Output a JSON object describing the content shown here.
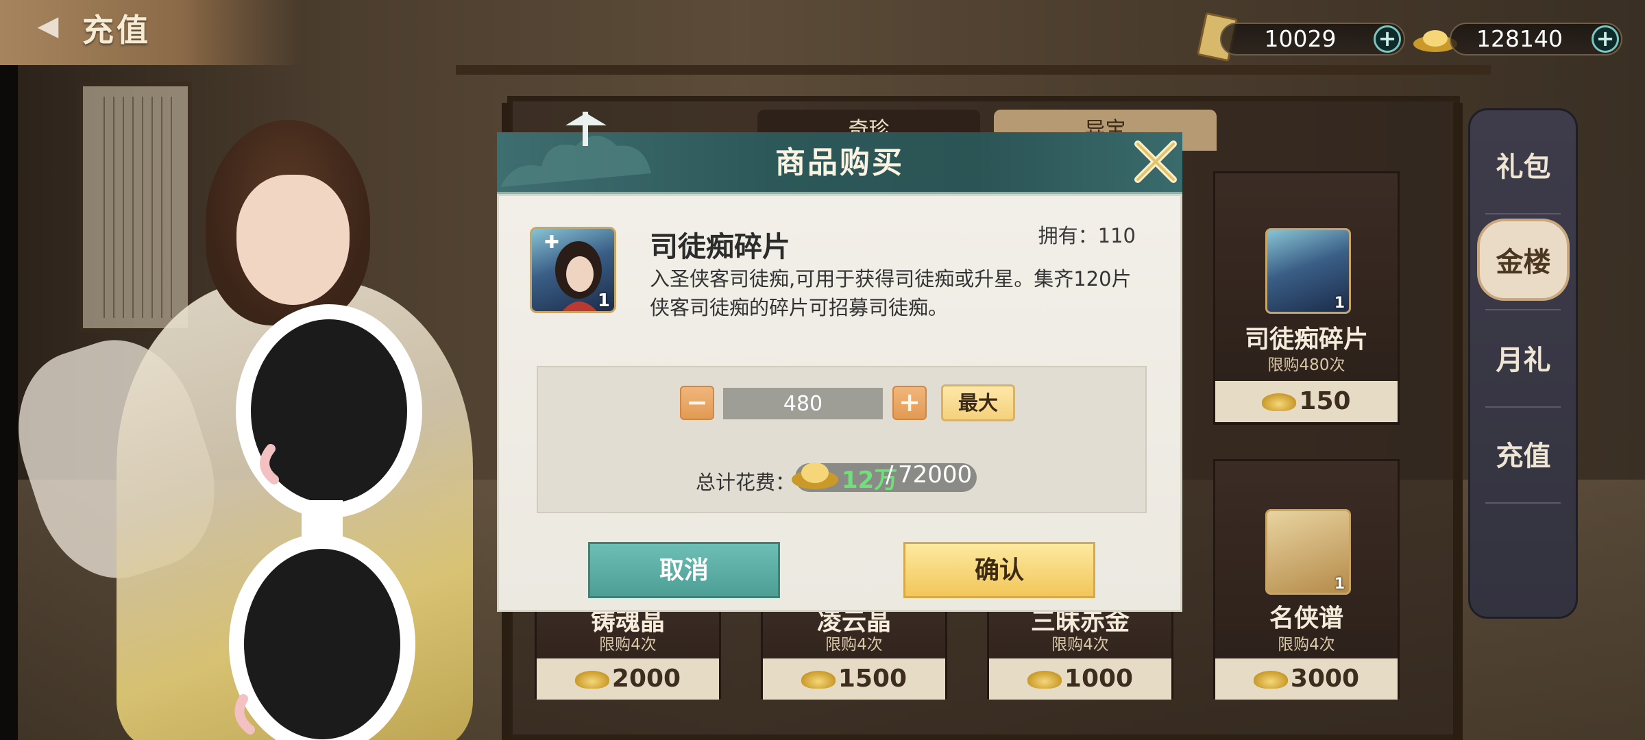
{
  "header": {
    "back_icon": "back-arrow-icon",
    "title": "充值"
  },
  "currencies": [
    {
      "icon": "ticket-icon",
      "value": "10029",
      "add_icon": "plus-icon"
    },
    {
      "icon": "gold-ingot-icon",
      "value": "128140",
      "add_icon": "plus-icon"
    }
  ],
  "side_nav": {
    "items": [
      {
        "label": "礼包",
        "active": false
      },
      {
        "label": "金楼",
        "active": true
      },
      {
        "label": "月礼",
        "active": false
      },
      {
        "label": "充值",
        "active": false
      }
    ]
  },
  "shop_tabs": [
    "奇珍",
    "异宝"
  ],
  "shop_cards": [
    {
      "name": "司徒痴碎片",
      "limit": "限购480次",
      "price": "150",
      "qty": "1",
      "icon": "character-portrait-icon"
    },
    {
      "name": "铸魂晶",
      "limit": "限购4次",
      "price": "2000"
    },
    {
      "name": "凌云晶",
      "limit": "限购4次",
      "price": "1500"
    },
    {
      "name": "三昧赤金",
      "limit": "限购4次",
      "price": "1000"
    },
    {
      "name": "名侠谱",
      "limit": "限购4次",
      "price": "3000",
      "qty": "1",
      "icon": "scroll-icon"
    }
  ],
  "dialog": {
    "title": "商品购买",
    "close_icon": "close-x-icon",
    "item": {
      "icon": "character-portrait-icon",
      "icon_qty": "1",
      "name": "司徒痴碎片",
      "owned_label": "拥有：110",
      "description": "入圣侠客司徒痴,可用于获得司徒痴或升星。集齐120片侠客司徒痴的碎片可招募司徒痴。"
    },
    "quantity": {
      "minus_label": "−",
      "value": "480",
      "plus_label": "+",
      "max_label": "最大"
    },
    "cost": {
      "label": "总计花费：",
      "have": "12万",
      "separator": "/",
      "need": "72000"
    },
    "cancel_label": "取消",
    "confirm_label": "确认"
  },
  "colors": {
    "dialog_header": "#2d5859",
    "cancel_button": "#4d9e94",
    "confirm_button": "#f2c65a",
    "stepper_button": "#e29a55",
    "cost_have_text": "#6fe07a"
  }
}
